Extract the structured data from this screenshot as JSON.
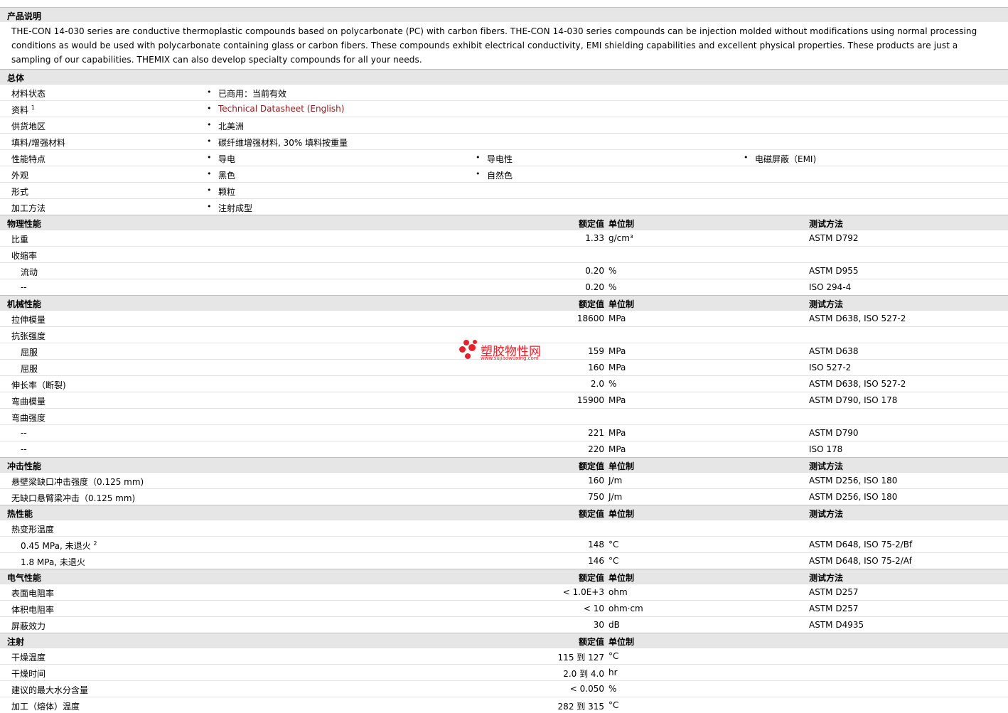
{
  "description": {
    "title": "产品说明",
    "text": "THE-CON 14-030 series are conductive thermoplastic compounds based on polycarbonate (PC) with carbon fibers. THE-CON 14-030 series compounds can be injection molded without modifications using normal processing conditions as would be used with polycarbonate containing glass or carbon fibers. These compounds exhibit electrical conductivity, EMI shielding capabilities and excellent physical properties. These products are just a sampling of our capabilities. THEMIX can also develop specialty compounds for all your needs."
  },
  "general": {
    "title": "总体",
    "rows": [
      {
        "label": "材料状态",
        "items": [
          "已商用：当前有效"
        ]
      },
      {
        "label": "资料",
        "sup": "1",
        "items": [
          "Technical Datasheet (English)"
        ],
        "link": true
      },
      {
        "label": "供货地区",
        "items": [
          "北美洲"
        ]
      },
      {
        "label": "填料/增强材料",
        "items": [
          "碳纤维增强材料, 30% 填料按重量"
        ]
      },
      {
        "label": "性能特点",
        "items": [
          "导电",
          "导电性",
          "电磁屏蔽（EMI)"
        ]
      },
      {
        "label": "外观",
        "items": [
          "黑色",
          "自然色"
        ]
      },
      {
        "label": "形式",
        "items": [
          "颗粒"
        ]
      },
      {
        "label": "加工方法",
        "items": [
          "注射成型"
        ]
      }
    ]
  },
  "headers": {
    "value": "额定值",
    "unit": "单位制",
    "method": "测试方法"
  },
  "sections": [
    {
      "title": "物理性能",
      "show_method": true,
      "rows": [
        {
          "label": "比重",
          "value": "1.33",
          "unit": "g/cm³",
          "method": "ASTM D792"
        },
        {
          "label": "收缩率"
        },
        {
          "label": "流动",
          "sub": true,
          "value": "0.20",
          "unit": "%",
          "method": "ASTM D955"
        },
        {
          "label": "--",
          "sub": true,
          "value": "0.20",
          "unit": "%",
          "method": "ISO 294-4"
        }
      ]
    },
    {
      "title": "机械性能",
      "show_method": true,
      "rows": [
        {
          "label": "拉伸模量",
          "value": "18600",
          "unit": "MPa",
          "method": "ASTM D638, ISO 527-2"
        },
        {
          "label": "抗张强度"
        },
        {
          "label": "屈服",
          "sub": true,
          "value": "159",
          "unit": "MPa",
          "method": "ASTM D638"
        },
        {
          "label": "屈服",
          "sub": true,
          "value": "160",
          "unit": "MPa",
          "method": "ISO 527-2"
        },
        {
          "label": "伸长率（断裂)",
          "value": "2.0",
          "unit": "%",
          "method": "ASTM D638, ISO 527-2"
        },
        {
          "label": "弯曲模量",
          "value": "15900",
          "unit": "MPa",
          "method": "ASTM D790, ISO 178"
        },
        {
          "label": "弯曲强度"
        },
        {
          "label": "--",
          "sub": true,
          "value": "221",
          "unit": "MPa",
          "method": "ASTM D790"
        },
        {
          "label": "--",
          "sub": true,
          "value": "220",
          "unit": "MPa",
          "method": "ISO 178"
        }
      ]
    },
    {
      "title": "冲击性能",
      "show_method": true,
      "rows": [
        {
          "label": "悬壁梁缺口冲击强度（0.125 mm)",
          "value": "160",
          "unit": "J/m",
          "method": "ASTM D256, ISO 180"
        },
        {
          "label": "无缺口悬臂梁冲击（0.125 mm)",
          "value": "750",
          "unit": "J/m",
          "method": "ASTM D256, ISO 180"
        }
      ]
    },
    {
      "title": "热性能",
      "show_method": true,
      "rows": [
        {
          "label": "热变形温度"
        },
        {
          "label": "0.45 MPa, 未退火",
          "sup": "2",
          "sub": true,
          "value": "148",
          "unit": "°C",
          "method": "ASTM D648, ISO 75-2/Bf"
        },
        {
          "label": "1.8 MPa, 未退火",
          "sub": true,
          "value": "146",
          "unit": "°C",
          "method": "ASTM D648, ISO 75-2/Af"
        }
      ]
    },
    {
      "title": "电气性能",
      "show_method": true,
      "rows": [
        {
          "label": "表面电阻率",
          "value": "< 1.0E+3",
          "unit": "ohm",
          "method": "ASTM D257"
        },
        {
          "label": "体积电阻率",
          "value": "< 10",
          "unit": "ohm·cm",
          "method": "ASTM D257"
        },
        {
          "label": "屏蔽效力",
          "value": "30",
          "unit": "dB",
          "method": "ASTM D4935"
        }
      ]
    },
    {
      "title": "注射",
      "show_method": false,
      "rows": [
        {
          "label": "干燥温度",
          "value": "115 到  127",
          "unit": "°C"
        },
        {
          "label": "干燥时间",
          "value": "2.0 到  4.0",
          "unit": "hr"
        },
        {
          "label": "建议的最大水分含量",
          "value": "< 0.050",
          "unit": "%"
        },
        {
          "label": "加工（熔体）温度",
          "value": "282 到  315",
          "unit": "°C"
        }
      ]
    }
  ],
  "watermark": {
    "brand": "塑胶物性网",
    "url": "www.sujiaowuxing.com",
    "color": "#e8202a"
  }
}
